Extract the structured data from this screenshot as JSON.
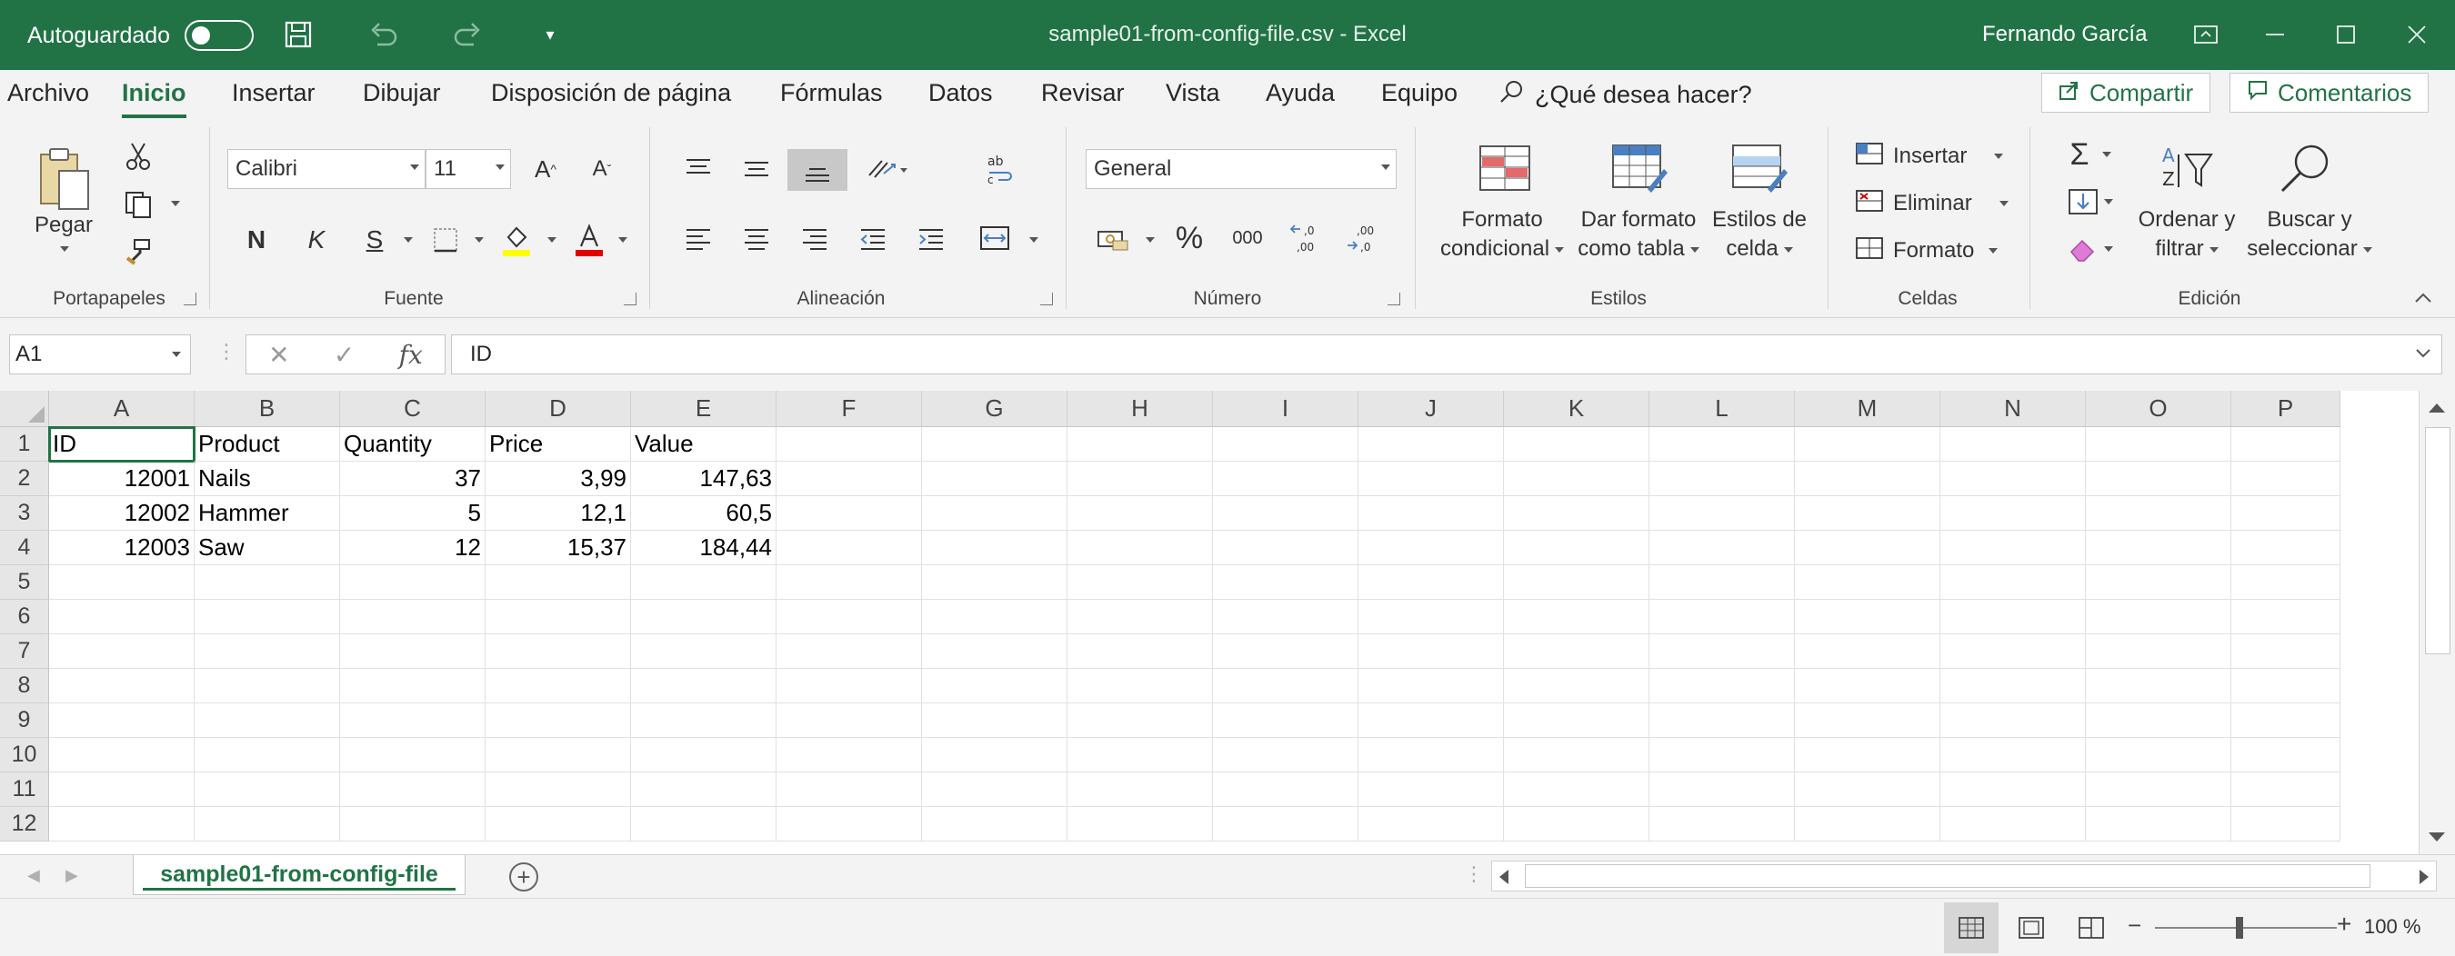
{
  "titlebar": {
    "autosave_label": "Autoguardado",
    "document_title": "sample01-from-config-file.csv  -  Excel",
    "user_name": "Fernando García"
  },
  "tabs": [
    "Archivo",
    "Inicio",
    "Insertar",
    "Dibujar",
    "Disposición de página",
    "Fórmulas",
    "Datos",
    "Revisar",
    "Vista",
    "Ayuda",
    "Equipo"
  ],
  "active_tab": "Inicio",
  "tell_me": "¿Qué desea hacer?",
  "share_label": "Compartir",
  "comments_label": "Comentarios",
  "ribbon": {
    "portapapeles": {
      "label": "Portapapeles",
      "paste_label": "Pegar"
    },
    "fuente": {
      "label": "Fuente",
      "font_name": "Calibri",
      "font_size": "11",
      "bold": "N",
      "italic": "K",
      "underline": "S",
      "grow": "A",
      "shrink": "A"
    },
    "alineacion": {
      "label": "Alineación",
      "wrap": "ab"
    },
    "numero": {
      "label": "Número",
      "format": "General",
      "percent": "%",
      "thousands": "000"
    },
    "estilos": {
      "label": "Estilos",
      "cond_format_1": "Formato",
      "cond_format_2": "condicional",
      "table_1": "Dar formato",
      "table_2": "como tabla",
      "cell_1": "Estilos de",
      "cell_2": "celda"
    },
    "celdas": {
      "label": "Celdas",
      "insert": "Insertar",
      "delete": "Eliminar",
      "format": "Formato"
    },
    "edicion": {
      "label": "Edición",
      "sort_1": "Ordenar y",
      "sort_2": "filtrar",
      "find_1": "Buscar y",
      "find_2": "seleccionar"
    }
  },
  "formula_bar": {
    "name_box": "A1",
    "formula": "ID",
    "fx": "fx"
  },
  "grid": {
    "columns": [
      "A",
      "B",
      "C",
      "D",
      "E",
      "F",
      "G",
      "H",
      "I",
      "J",
      "K",
      "L",
      "M",
      "N",
      "O",
      "P"
    ],
    "rows": [
      "1",
      "2",
      "3",
      "4",
      "5",
      "6",
      "7",
      "8",
      "9",
      "10",
      "11",
      "12"
    ],
    "data": [
      [
        "ID",
        "Product",
        "Quantity",
        "Price",
        "Value"
      ],
      [
        "12001",
        "Nails",
        "37",
        "3,99",
        "147,63"
      ],
      [
        "12002",
        "Hammer",
        "5",
        "12,1",
        "60,5"
      ],
      [
        "12003",
        "Saw",
        "12",
        "15,37",
        "184,44"
      ]
    ]
  },
  "sheet_tab": "sample01-from-config-file",
  "status": {
    "zoom": "100 %"
  },
  "colors": {
    "accent": "#217346",
    "excel_green": "#217346"
  }
}
